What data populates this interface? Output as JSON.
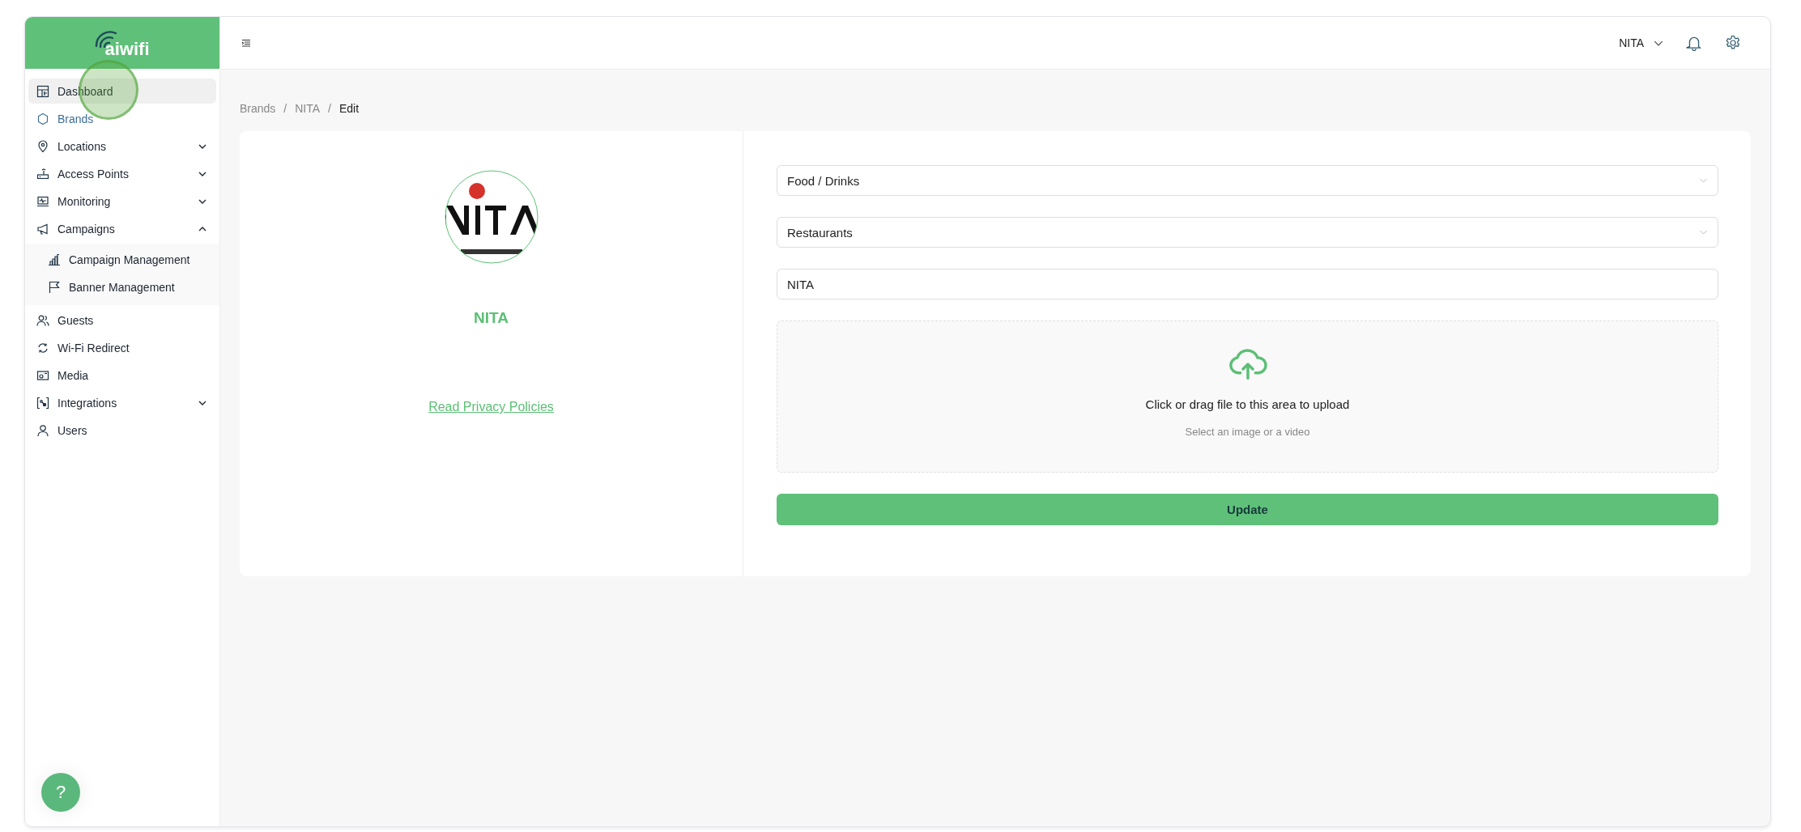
{
  "logo": {
    "text": "aiwifi"
  },
  "sidebar": {
    "items": [
      {
        "label": "Dashboard",
        "kind": "link",
        "selected": false,
        "highlighted": true
      },
      {
        "label": "Brands",
        "kind": "link",
        "selected": true,
        "highlighted": false
      },
      {
        "label": "Locations",
        "kind": "group",
        "expanded": false,
        "selected": false,
        "highlighted": false
      },
      {
        "label": "Access Points",
        "kind": "group",
        "expanded": false,
        "selected": false,
        "highlighted": false
      },
      {
        "label": "Monitoring",
        "kind": "group",
        "expanded": false,
        "selected": false,
        "highlighted": false
      },
      {
        "label": "Campaigns",
        "kind": "group",
        "expanded": true,
        "selected": false,
        "highlighted": false,
        "children": [
          {
            "label": "Campaign Management",
            "selected": false
          },
          {
            "label": "Banner Management",
            "selected": false
          }
        ]
      },
      {
        "label": "Guests",
        "kind": "link",
        "selected": false,
        "highlighted": false
      },
      {
        "label": "Wi-Fi Redirect",
        "kind": "link",
        "selected": false,
        "highlighted": false
      },
      {
        "label": "Media",
        "kind": "link",
        "selected": false,
        "highlighted": false
      },
      {
        "label": "Integrations",
        "kind": "group",
        "expanded": false,
        "selected": false,
        "highlighted": false
      },
      {
        "label": "Users",
        "kind": "link",
        "selected": false,
        "highlighted": false
      }
    ]
  },
  "header": {
    "account": "NITA"
  },
  "breadcrumb": [
    {
      "label": "Brands",
      "current": false
    },
    {
      "separator": "/",
      "label": "NITA",
      "current": false
    },
    {
      "separator": "/",
      "label": "Edit",
      "current": true
    }
  ],
  "brand": {
    "name": "NITA",
    "link": "Read Privacy Policies"
  },
  "form": {
    "fields": [
      {
        "kind": "select",
        "value": "Food / Drinks"
      },
      {
        "kind": "select",
        "value": "Restaurants"
      },
      {
        "kind": "text",
        "value": "NITA"
      }
    ],
    "upload": {
      "title": "Click or drag file to this area to upload",
      "hint": "Select an image or a video"
    },
    "submit": "Update"
  },
  "help": {
    "label": "?"
  }
}
